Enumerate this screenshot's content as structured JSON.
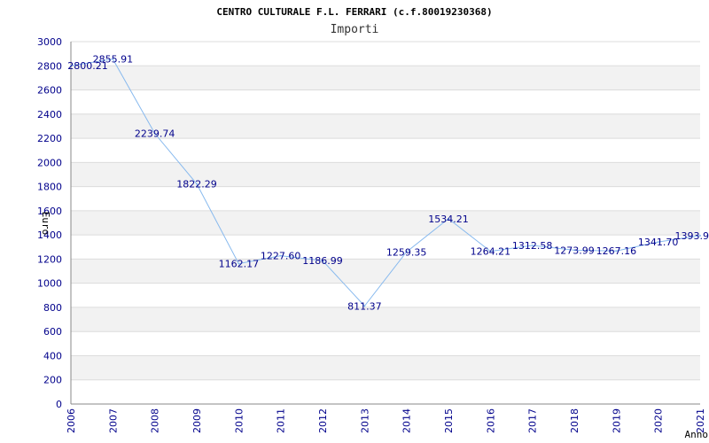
{
  "chart_data": {
    "type": "line",
    "title": "CENTRO CULTURALE F.L. FERRARI (c.f.80019230368)",
    "subtitle": "Importi",
    "xlabel": "Anno",
    "ylabel": "Euro",
    "categories": [
      "2006",
      "2007",
      "2008",
      "2009",
      "2010",
      "2011",
      "2012",
      "2013",
      "2014",
      "2015",
      "2016",
      "2017",
      "2018",
      "2019",
      "2020",
      "2021"
    ],
    "series": [
      {
        "values": [
          2800.21,
          2855.91,
          2239.74,
          1822.29,
          1162.17,
          1227.6,
          1186.99,
          811.37,
          1259.35,
          1534.21,
          1264.21,
          1312.58,
          1273.99,
          1267.16,
          1341.7,
          1393.9
        ],
        "labels": [
          "2800.21",
          "2855.91",
          "2239.74",
          "1822.29",
          "1162.17",
          "1227.60",
          "1186.99",
          "811.37",
          "1259.35",
          "1534.21",
          "1264.21",
          "1312.58",
          "1273.99",
          "1267.16",
          "1341.70",
          "1393.9"
        ]
      }
    ],
    "ylim": [
      0,
      3000
    ],
    "yticks": [
      "0",
      "200",
      "400",
      "600",
      "800",
      "1000",
      "1200",
      "1400",
      "1600",
      "1800",
      "2000",
      "2200",
      "2400",
      "2600",
      "2800",
      "3000"
    ],
    "grid": true,
    "line_color": "#87b9ee",
    "band_color": "#f2f2f2",
    "tick_color": "#00008b"
  }
}
